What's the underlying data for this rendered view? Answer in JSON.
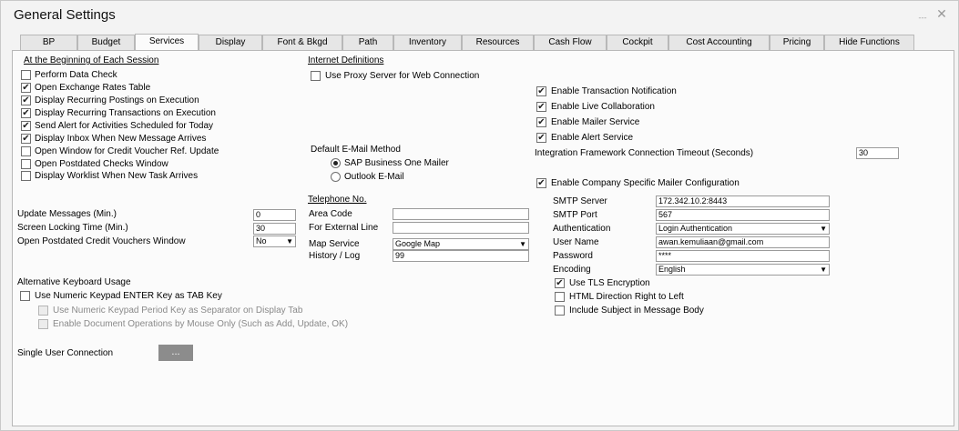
{
  "window": {
    "title": "General Settings",
    "minimize_glyph": "﹍",
    "close_glyph": "✕"
  },
  "tabs": [
    {
      "label": "BP"
    },
    {
      "label": "Budget"
    },
    {
      "label": "Services"
    },
    {
      "label": "Display"
    },
    {
      "label": "Font & Bkgd"
    },
    {
      "label": "Path"
    },
    {
      "label": "Inventory"
    },
    {
      "label": "Resources"
    },
    {
      "label": "Cash Flow"
    },
    {
      "label": "Cockpit"
    },
    {
      "label": "Cost Accounting"
    },
    {
      "label": "Pricing"
    },
    {
      "label": "Hide Functions"
    }
  ],
  "active_tab": "Services",
  "session": {
    "heading": "At the Beginning of Each Session",
    "items": [
      {
        "label": "Perform Data Check",
        "checked": false
      },
      {
        "label": "Open Exchange Rates Table",
        "checked": true
      },
      {
        "label": "Display Recurring Postings on Execution",
        "checked": true
      },
      {
        "label": "Display Recurring Transactions on Execution",
        "checked": true
      },
      {
        "label": "Send Alert for Activities Scheduled for Today",
        "checked": true
      },
      {
        "label": "Display Inbox When New Message Arrives",
        "checked": true
      },
      {
        "label": "Open Window for Credit Voucher Ref. Update",
        "checked": false
      },
      {
        "label": "Open Postdated Checks Window",
        "checked": false
      },
      {
        "label": "Display Worklist When New Task Arrives",
        "checked": false
      }
    ]
  },
  "misc": {
    "update_messages_label": "Update Messages (Min.)",
    "update_messages_value": "0",
    "screen_lock_label": "Screen Locking Time (Min.)",
    "screen_lock_value": "30",
    "postdated_label": "Open Postdated Credit Vouchers Window",
    "postdated_value": "No"
  },
  "keyboard": {
    "heading": "Alternative Keyboard Usage",
    "numeric_enter": {
      "label": "Use Numeric Keypad ENTER Key as TAB Key",
      "checked": false
    },
    "period_sep": {
      "label": "Use Numeric Keypad Period Key as Separator on Display Tab",
      "checked": false
    },
    "mouse_only": {
      "label": "Enable Document Operations by Mouse Only (Such as Add, Update, OK)",
      "checked": false
    }
  },
  "single_user": {
    "label": "Single User Connection",
    "button": "..."
  },
  "internet": {
    "heading": "Internet Definitions",
    "proxy": {
      "label": "Use Proxy Server for Web Connection",
      "checked": false
    }
  },
  "email_method": {
    "heading": "Default E-Mail Method",
    "options": [
      {
        "label": "SAP Business One Mailer",
        "selected": true
      },
      {
        "label": "Outlook E-Mail",
        "selected": false
      }
    ]
  },
  "telephone": {
    "heading": "Telephone No.",
    "area_code_label": "Area Code",
    "area_code_value": "",
    "external_line_label": "For External Line",
    "external_line_value": "",
    "map_service_label": "Map Service",
    "map_service_value": "Google Map",
    "history_label": "History / Log",
    "history_value": "99"
  },
  "integration": {
    "items": [
      {
        "label": "Enable Transaction Notification",
        "checked": true
      },
      {
        "label": "Enable Live Collaboration",
        "checked": true
      },
      {
        "label": "Enable Mailer Service",
        "checked": true
      },
      {
        "label": "Enable Alert Service",
        "checked": true
      }
    ],
    "timeout_label": "Integration Framework Connection Timeout (Seconds)",
    "timeout_value": "30"
  },
  "mailer": {
    "company_specific": {
      "label": "Enable Company Specific Mailer Configuration",
      "checked": true
    },
    "smtp_server_label": "SMTP Server",
    "smtp_server_value": "172.342.10.2:8443",
    "smtp_port_label": "SMTP Port",
    "smtp_port_value": "567",
    "auth_label": "Authentication",
    "auth_value": "Login Authentication",
    "user_label": "User Name",
    "user_value": "awan.kemuliaan@gmail.com",
    "password_label": "Password",
    "password_value": "****",
    "encoding_label": "Encoding",
    "encoding_value": "English",
    "tls": {
      "label": "Use TLS Encryption",
      "checked": true
    },
    "rtl": {
      "label": "HTML Direction Right to Left",
      "checked": false
    },
    "subject": {
      "label": "Include Subject in Message Body",
      "checked": false
    }
  },
  "glyphs": {
    "check": "✔",
    "dropdown": "▼"
  }
}
